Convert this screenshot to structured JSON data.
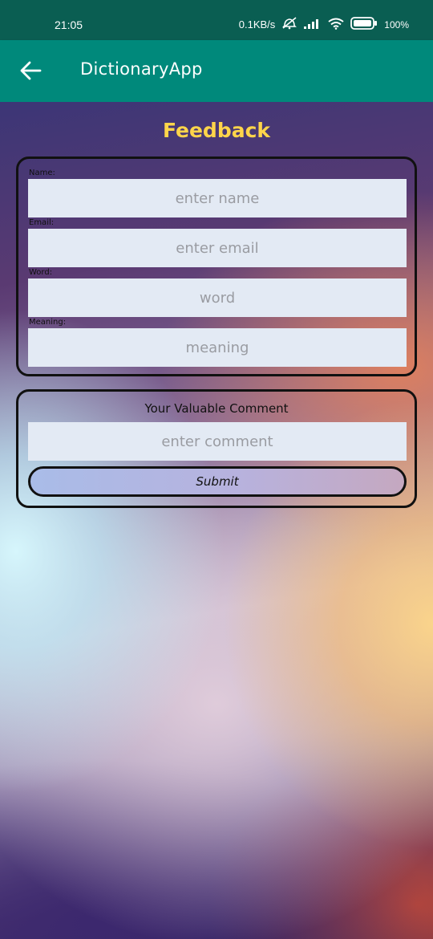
{
  "status_bar": {
    "time": "21:05",
    "speed": "0.1KB/s",
    "battery": "100%"
  },
  "app_bar": {
    "title": "DictionaryApp"
  },
  "page": {
    "heading": "Feedback"
  },
  "form": {
    "name": {
      "label": "Name:",
      "placeholder": "enter name",
      "value": ""
    },
    "email": {
      "label": "Email:",
      "placeholder": "enter email",
      "value": ""
    },
    "word": {
      "label": "Word:",
      "placeholder": "word",
      "value": ""
    },
    "meaning": {
      "label": "Meaning:",
      "placeholder": "meaning",
      "value": ""
    }
  },
  "comment": {
    "title": "Your Valuable Comment",
    "placeholder": "enter comment",
    "value": "",
    "submit_label": "Submit"
  },
  "colors": {
    "status_bar": "#0a5e52",
    "app_bar": "#00897b",
    "heading": "#ffd54a",
    "input_bg": "#e3eaf4"
  }
}
